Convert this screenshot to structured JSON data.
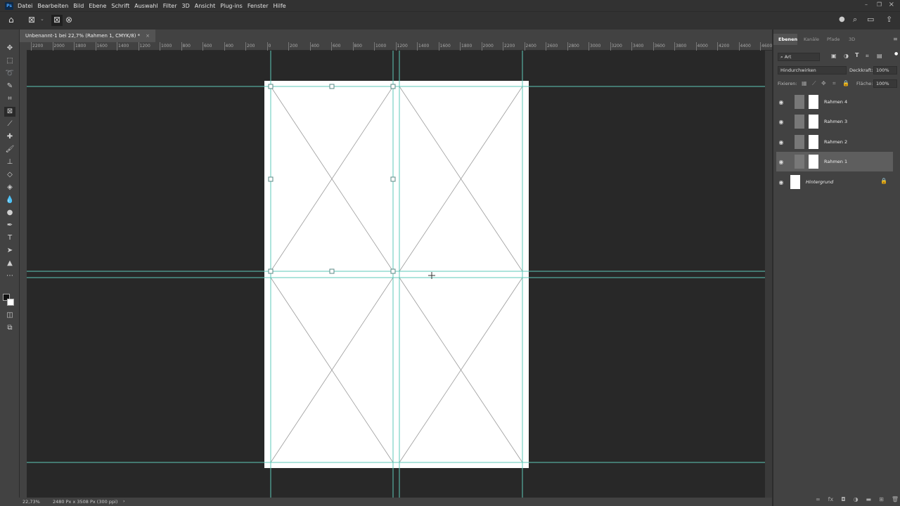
{
  "app": {
    "logo": "Ps"
  },
  "menu": [
    "Datei",
    "Bearbeiten",
    "Bild",
    "Ebene",
    "Schrift",
    "Auswahl",
    "Filter",
    "3D",
    "Ansicht",
    "Plug-ins",
    "Fenster",
    "Hilfe"
  ],
  "document_tab": {
    "title": "Unbenannt-1 bei 22,7% (Rahmen 1, CMYK/8) *",
    "close": "×"
  },
  "ruler": {
    "labels": [
      "2200",
      "2000",
      "1800",
      "1600",
      "1400",
      "1200",
      "1000",
      "800",
      "600",
      "400",
      "200",
      "0",
      "200",
      "400",
      "600",
      "800",
      "1000",
      "1200",
      "1400",
      "1600",
      "1800",
      "2000",
      "2200",
      "2400",
      "2600",
      "2800",
      "3000",
      "3200",
      "3400",
      "3600",
      "3800",
      "4000",
      "4200",
      "4400",
      "4600"
    ]
  },
  "panel": {
    "tabs": [
      "Ebenen",
      "Kanäle",
      "Pfade",
      "3D"
    ],
    "filter": "Art",
    "blend_mode": "Hindurchwirken",
    "opacity_label": "Deckkraft:",
    "opacity": "100%",
    "lock_label": "Fixieren:",
    "fill_label": "Fläche:",
    "fill": "100%",
    "layers": [
      {
        "name": "Rahmen 4",
        "selected": false
      },
      {
        "name": "Rahmen 3",
        "selected": false
      },
      {
        "name": "Rahmen 2",
        "selected": false
      },
      {
        "name": "Rahmen 1",
        "selected": true
      },
      {
        "name": "Hintergrund",
        "selected": false,
        "locked": true
      }
    ]
  },
  "status": {
    "zoom": "22,73%",
    "doc_info": "2480 Px x 3508 Px (300 ppi)",
    "arrow": "›"
  },
  "colors": {
    "guide": "#5ec8b8",
    "canvas_bg": "#282828",
    "panel": "#424242",
    "selected_layer": "#5e5e5e"
  }
}
